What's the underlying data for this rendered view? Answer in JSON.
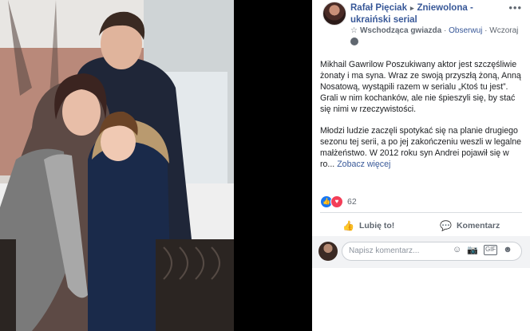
{
  "post": {
    "author": "Rafał Pięciak",
    "arrow": "▸",
    "page": "Zniewolona - ukraiński serial",
    "badge": "Wschodząca gwiazda",
    "follow": "Obserwuj",
    "separator": "·",
    "time": "Wczoraj",
    "paragraph1": "Mikhail Gawrilow Poszukiwany aktor jest szczęśliwie żonaty i ma syna. Wraz ze swoją przyszłą żoną, Anną Nosatową, wystąpili razem w serialu „Ktoś tu jest”. Grali w nim kochanków, ale nie śpieszyli się, by stać się nimi w rzeczywistości.",
    "paragraph2": "Młodzi ludzie zaczęli spotykać się na planie drugiego sezonu tej serii, a po jej zakończeniu weszli w legalne małżeństwo. W 2012 roku syn Andrei pojawił się w ro...",
    "see_more": "Zobacz więcej",
    "reaction_count": "62"
  },
  "actions": {
    "like": "Lubię to!",
    "comment": "Komentarz"
  },
  "comment_box": {
    "placeholder": "Napisz komentarz..."
  },
  "icons": {
    "more": "more-options-icon",
    "globe": "globe-icon",
    "star": "star-icon",
    "like": "thumbs-up-icon",
    "comment": "speech-bubble-icon",
    "emoji": "emoji-icon",
    "camera": "camera-icon",
    "gif": "gif-icon",
    "sticker": "sticker-icon"
  },
  "colors": {
    "link": "#385898",
    "like": "#1877f2",
    "love": "#f33e58"
  }
}
